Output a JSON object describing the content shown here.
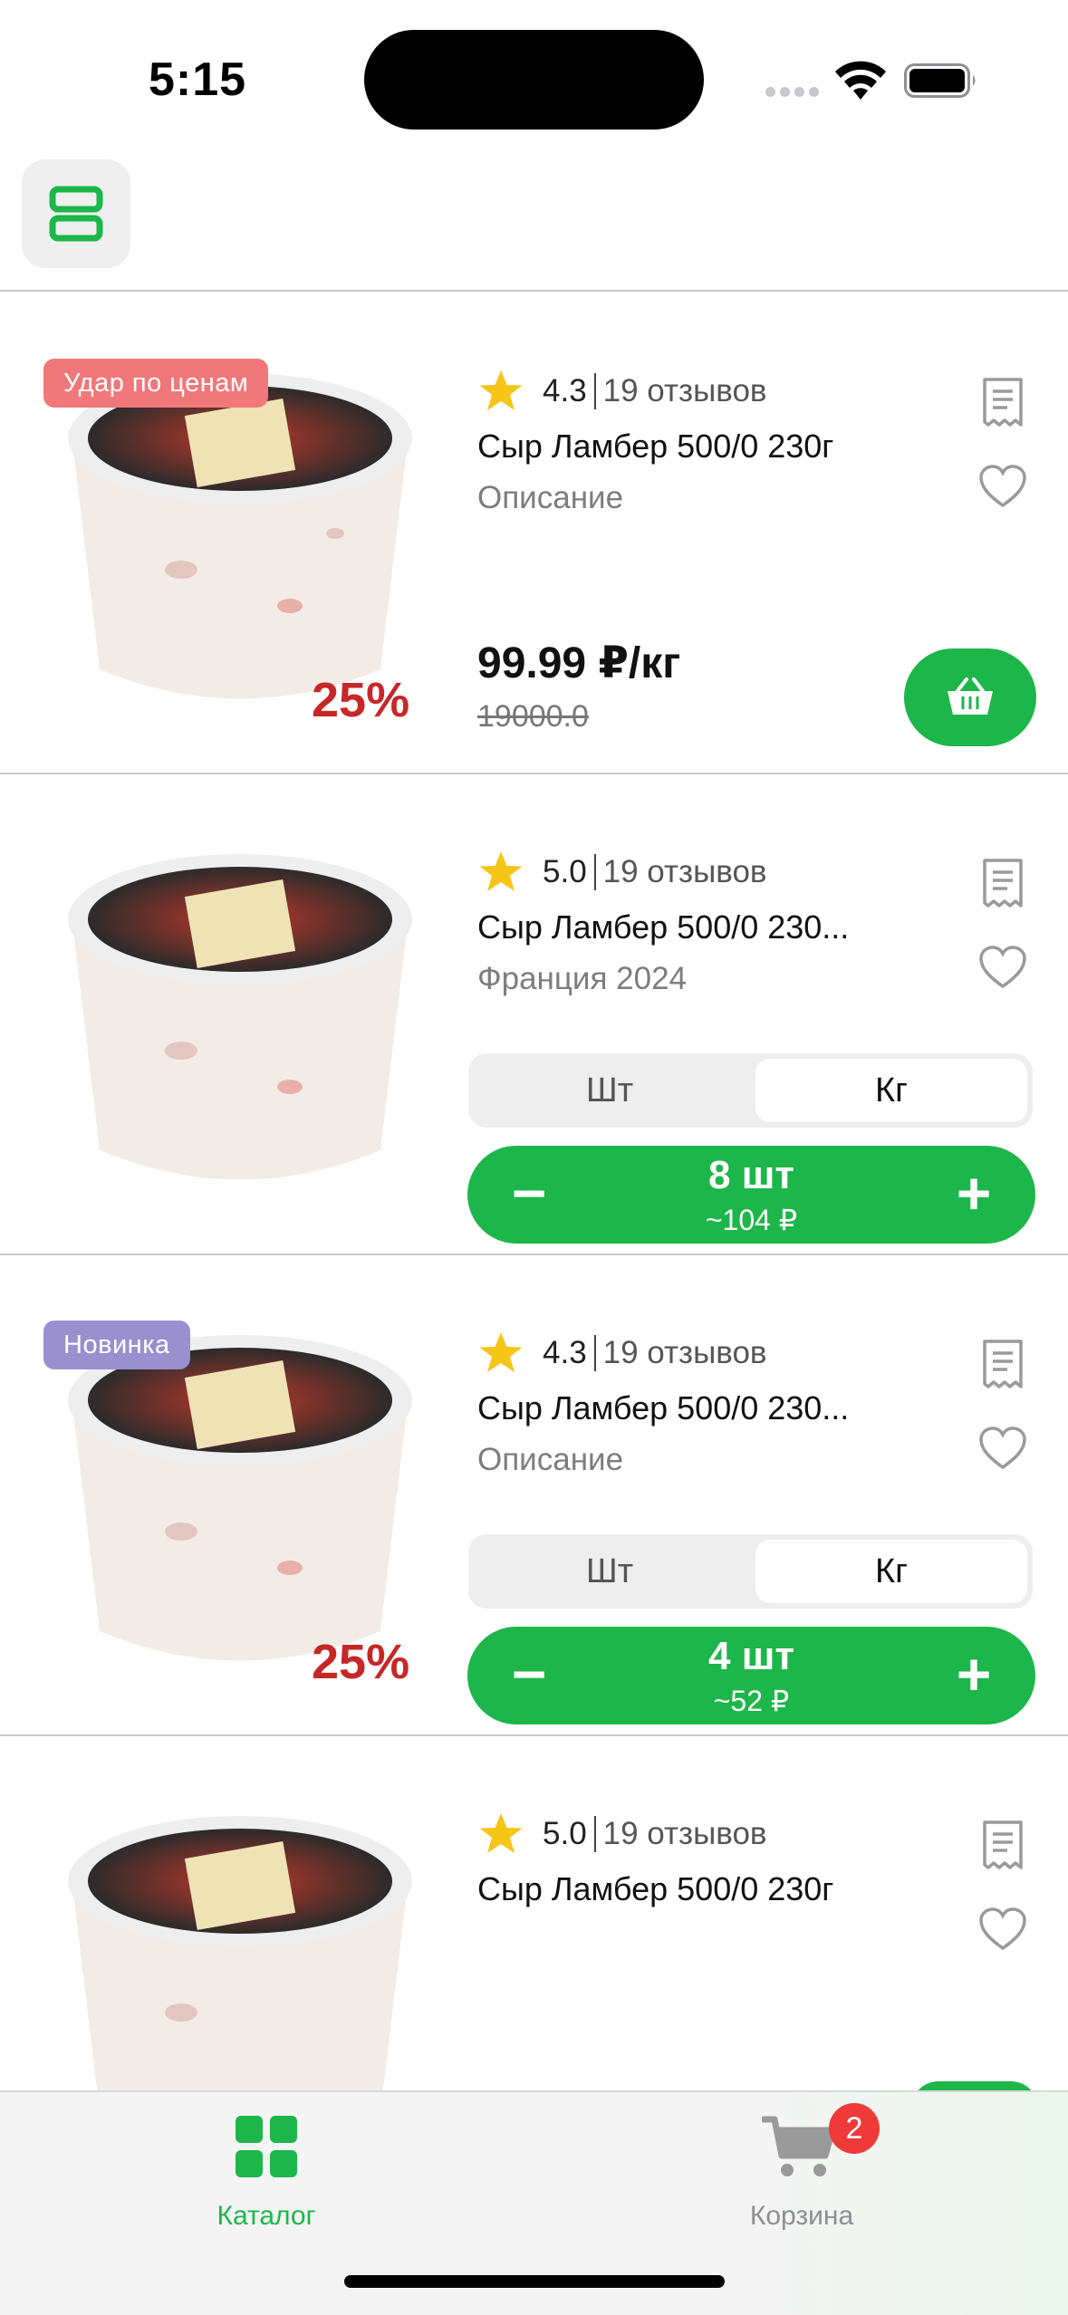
{
  "status_bar": {
    "time": "5:15"
  },
  "colors": {
    "accent": "#1db64a",
    "discount": "#c62828",
    "badge_sale": "#f0787a",
    "badge_new": "#9a8fcf",
    "star": "#f5c518",
    "cart_badge": "#f03a3a"
  },
  "icons": {
    "layout_toggle": "layout-list-icon",
    "review_doc": "receipt-icon",
    "favorite": "heart-icon",
    "add_to_cart": "basket-icon",
    "catalog": "grid-icon",
    "cart": "cart-icon"
  },
  "products": [
    {
      "badge": "Удар по ценам",
      "discount": "25%",
      "rating": "4.3",
      "reviews": "19 отзывов",
      "title": "Сыр Ламбер 500/0 230г",
      "subtitle": "Описание",
      "price": "99.99 ₽/кг",
      "old_price": "19000.0"
    },
    {
      "rating": "5.0",
      "reviews": "19 отзывов",
      "title": "Сыр Ламбер 500/0 230...",
      "subtitle": "Франция 2024",
      "unit_left": "Шт",
      "unit_right": "Кг",
      "quantity": "8 шт",
      "sum": "~104 ₽",
      "minus": "−",
      "plus": "+"
    },
    {
      "badge": "Новинка",
      "discount": "25%",
      "rating": "4.3",
      "reviews": "19 отзывов",
      "title": "Сыр Ламбер 500/0 230...",
      "subtitle": "Описание",
      "unit_left": "Шт",
      "unit_right": "Кг",
      "quantity": "4 шт",
      "sum": "~52 ₽",
      "minus": "−",
      "plus": "+"
    },
    {
      "rating": "5.0",
      "reviews": "19 отзывов",
      "title": "Сыр Ламбер 500/0 230г"
    }
  ],
  "tabbar": {
    "catalog_label": "Каталог",
    "cart_label": "Корзина",
    "cart_count": "2"
  }
}
